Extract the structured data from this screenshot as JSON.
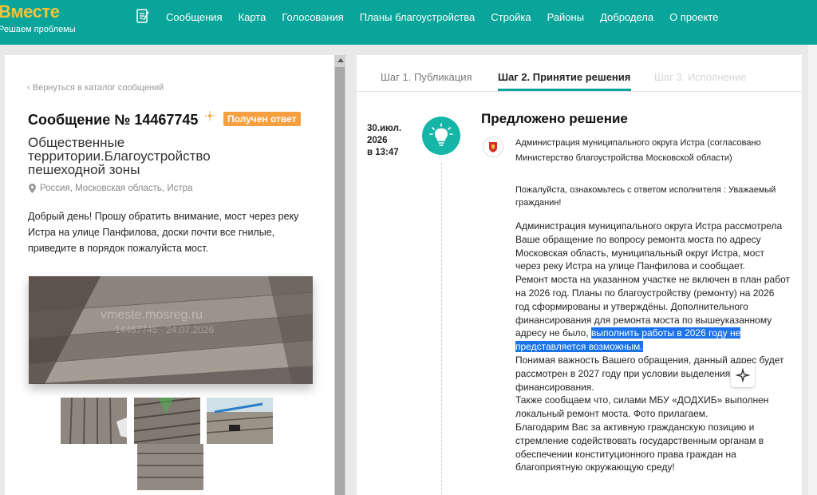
{
  "header": {
    "logo_title": "Вместе",
    "logo_subtitle": "Решаем проблемы",
    "nav": [
      "Сообщения",
      "Карта",
      "Голосования",
      "Планы благоустройства",
      "Стройка",
      "Районы",
      "Добродела",
      "О проекте"
    ]
  },
  "message": {
    "back_link": "Вернуться в каталог сообщений",
    "title": "Сообщение № 14467745",
    "status": "Получен ответ",
    "category": "Общественные территории.Благоустройство пешеходной зоны",
    "location": "Россия, Московская область, Истра",
    "text": "Добрый день! Прошу обратить внимание, мост через реку Истра на улице Панфилова, доски почти все гнилые, приведите в порядок пожалуйста мост.",
    "photo_watermark": "vmeste.mosreg.ru",
    "photo_watermark_2": "14467745 · 24.07.2026"
  },
  "steps": {
    "tab1": "Шаг 1. Публикация",
    "tab2": "Шаг 2. Принятие решения",
    "tab3": "Шаг 3. Исполнение"
  },
  "decision": {
    "date": "30.июл.",
    "year": "2026",
    "time": "в 13:47",
    "title": "Предложено решение",
    "org": "Администрация муниципального округа Истра (согласовано Министерство благоустройства Московской области)",
    "intro": "Пожалуйста, ознакомьтесь с ответом исполнителя : Уважаемый гражданин!",
    "answer_1": "Администрация муниципального округа Истра рассмотрела Ваше обращение по вопросу ремонта моста  по адресу Московская область, муниципальный округ Истра,  мост через реку Истра на улице Панфилова и сообщает.",
    "answer_2a": "Ремонт моста на указанном участке не включен в план работ на 2026 год. Планы по благоустройству (ремонту)  на 2026 год сформированы и утверждёны. Дополнительного финансирования для ремонта моста по вышеуказанному адресу не было, ",
    "answer_2_highlight": "выполнить работы в 2026 году не представляется возможным.",
    "answer_3": "Понимая важность Вашего обращения, данный адрес будет рассмотрен в 2027 году при условии выделения финансирования.",
    "answer_4": "Также сообщаем что, силами МБУ «ДОДХИБ» выполнен локальный ремонт моста. Фото прилагаем.",
    "answer_5": "Благодарим Вас за активную гражданскую позицию и стремление содействовать государственным органам в обеспечении конституционного права граждан на благоприятную окружающую среду!"
  },
  "colors": {
    "brand": "#0aa59a",
    "logo": "#f4c23a",
    "badge": "#f5a040",
    "highlight": "#1a73e8"
  }
}
